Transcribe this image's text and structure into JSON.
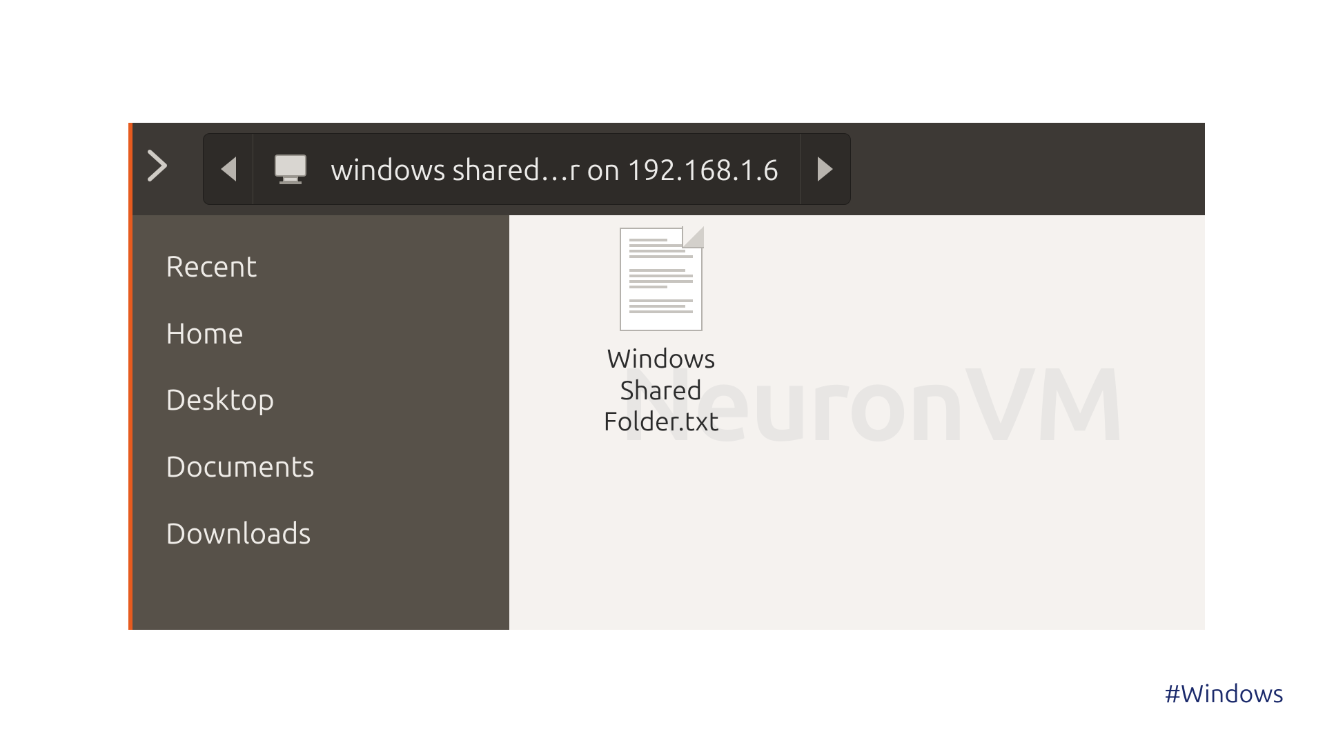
{
  "toolbar": {
    "path_label": "windows shared…r on 192.168.1.6"
  },
  "sidebar": {
    "items": [
      {
        "label": "Recent"
      },
      {
        "label": "Home"
      },
      {
        "label": "Desktop"
      },
      {
        "label": "Documents"
      },
      {
        "label": "Downloads"
      }
    ]
  },
  "content": {
    "files": [
      {
        "name": "Windows Shared Folder.txt"
      }
    ],
    "watermark": "NeuronVM"
  },
  "footer": {
    "hashtag": "#Windows"
  }
}
